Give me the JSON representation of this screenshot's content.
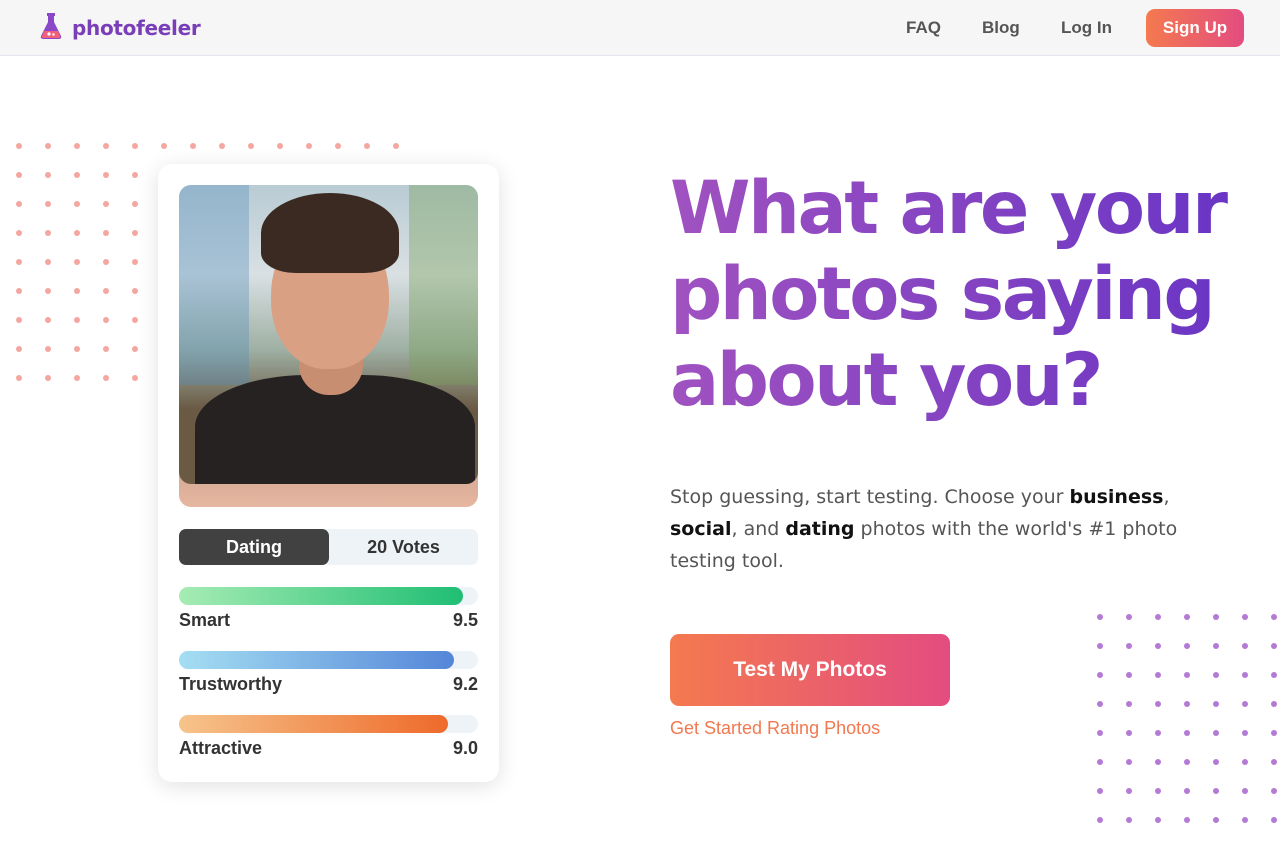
{
  "header": {
    "brand": "photofeeler",
    "nav": [
      "FAQ",
      "Blog",
      "Log In"
    ],
    "signup_label": "Sign Up"
  },
  "card": {
    "toggle_active": "Dating",
    "votes_label": "20 Votes",
    "metrics": [
      {
        "label": "Smart",
        "value": "9.5",
        "fill_fraction": 0.95
      },
      {
        "label": "Trustworthy",
        "value": "9.2",
        "fill_fraction": 0.92
      },
      {
        "label": "Attractive",
        "value": "9.0",
        "fill_fraction": 0.9
      }
    ]
  },
  "hero": {
    "title": "What are your photos saying about you?",
    "subtitle_parts": [
      "Stop guessing, start testing. Choose your ",
      "business",
      ", ",
      "social",
      ", and ",
      "dating",
      " photos with the world's #1 photo testing tool."
    ],
    "cta_label": "Test My Photos",
    "cta_link": "Get Started Rating Photos"
  },
  "colors": {
    "brand_purple": "#7a3fb8",
    "cta_gradient_start": "#f47a4f",
    "cta_gradient_end": "#e34c80",
    "smart_bar": "#1fbe73",
    "trust_bar": "#5486d8",
    "attractive_bar": "#ee6a2a"
  },
  "icons": {
    "logo": "flask-icon"
  }
}
